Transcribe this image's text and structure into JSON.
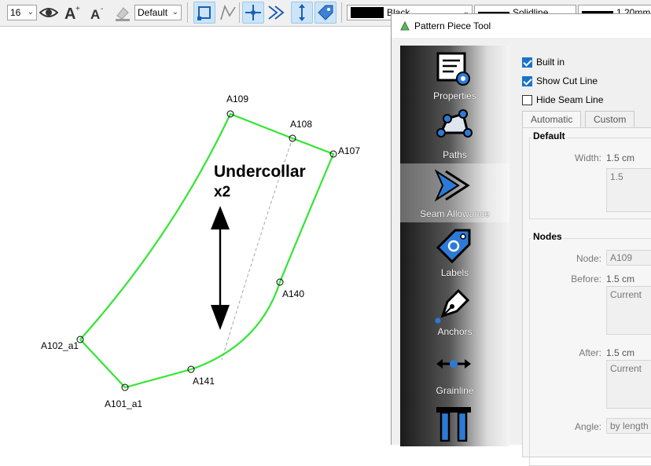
{
  "toolbar": {
    "font_size": "16",
    "style_select": "Default",
    "line_color": "Black",
    "line_type": "Solidline",
    "line_weight": "1.20mm"
  },
  "canvas": {
    "piece_name_line1": "Undercollar",
    "piece_name_line2": "x2",
    "points": {
      "a109": "A109",
      "a108": "A108",
      "a107": "A107",
      "a140": "A140",
      "a141": "A141",
      "a101": "A101_a1",
      "a102": "A102_a1"
    },
    "colors": {
      "outline": "#33e533",
      "grainline": "#000000",
      "seamline": "#a0a0a0"
    }
  },
  "dialog": {
    "title": "Pattern Piece Tool",
    "sidebar": [
      {
        "label": "Properties",
        "icon": "properties-icon"
      },
      {
        "label": "Paths",
        "icon": "paths-icon"
      },
      {
        "label": "Seam Allowance",
        "icon": "seam-allowance-icon"
      },
      {
        "label": "Labels",
        "icon": "labels-icon"
      },
      {
        "label": "Anchors",
        "icon": "anchors-icon"
      },
      {
        "label": "Grainline",
        "icon": "grainline-icon"
      },
      {
        "label": "",
        "icon": "pins-icon"
      }
    ],
    "checkboxes": {
      "built_in": "Built in",
      "show_cut_line": "Show Cut Line",
      "hide_seam_line": "Hide Seam Line"
    },
    "tabs": {
      "automatic": "Automatic",
      "custom": "Custom"
    },
    "default_group": {
      "title": "Default",
      "width_label": "Width:",
      "width_value": "1.5 cm",
      "width_formula": "1.5"
    },
    "nodes_group": {
      "title": "Nodes",
      "node_label": "Node:",
      "node_value": "A109",
      "before_label": "Before:",
      "before_value": "1.5 cm",
      "before_formula": "Current",
      "after_label": "After:",
      "after_value": "1.5 cm",
      "after_formula": "Current",
      "angle_label": "Angle:",
      "angle_value": "by length"
    },
    "accent": "#1a73c8"
  }
}
